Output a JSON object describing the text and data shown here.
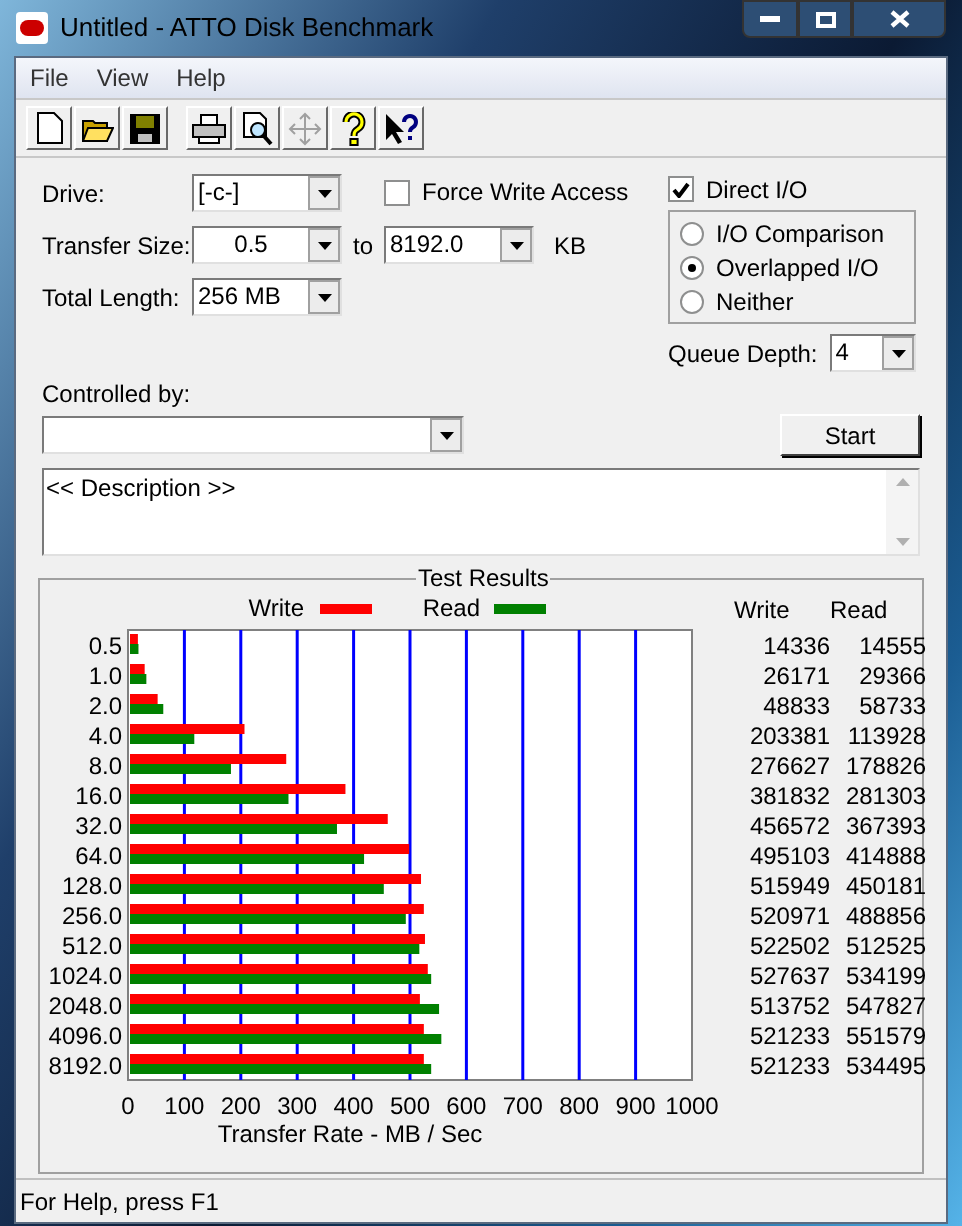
{
  "window": {
    "title": "Untitled - ATTO Disk Benchmark"
  },
  "menu": [
    "File",
    "View",
    "Help"
  ],
  "toolbar": [
    {
      "kind": "new",
      "disabled": false
    },
    {
      "kind": "open",
      "disabled": false
    },
    {
      "kind": "save",
      "disabled": false
    },
    {
      "kind": "print",
      "disabled": false
    },
    {
      "kind": "preview",
      "disabled": false
    },
    {
      "kind": "move",
      "disabled": true
    },
    {
      "kind": "help",
      "disabled": false
    },
    {
      "kind": "context-help",
      "disabled": false
    }
  ],
  "form": {
    "drive": {
      "label": "Drive:",
      "value": "[-c-]"
    },
    "force_write_access": {
      "label": "Force Write Access",
      "checked": false
    },
    "direct_io": {
      "label": "Direct I/O",
      "checked": true
    },
    "transfer_size": {
      "label": "Transfer Size:",
      "from": "0.5",
      "to_label": "to",
      "to": "8192.0",
      "unit": "KB"
    },
    "total_length": {
      "label": "Total Length:",
      "value": "256 MB"
    },
    "io_mode": [
      {
        "label": "I/O Comparison",
        "selected": false
      },
      {
        "label": "Overlapped I/O",
        "selected": true
      },
      {
        "label": "Neither",
        "selected": false
      }
    ],
    "queue_depth": {
      "label": "Queue Depth:",
      "value": "4"
    },
    "controlled_by": {
      "label": "Controlled by:"
    },
    "start_button": "Start",
    "description": "<< Description >>"
  },
  "test_results": {
    "title": "Test Results",
    "chart_data": {
      "type": "bar",
      "orientation": "horizontal",
      "grid": true,
      "legend": true,
      "xlabel": "Transfer Rate - MB / Sec",
      "xlim": [
        0,
        1000
      ],
      "xticks": [
        0,
        100,
        200,
        300,
        400,
        500,
        600,
        700,
        800,
        900,
        1000
      ],
      "categories": [
        "0.5",
        "1.0",
        "2.0",
        "4.0",
        "8.0",
        "16.0",
        "32.0",
        "64.0",
        "128.0",
        "256.0",
        "512.0",
        "1024.0",
        "2048.0",
        "4096.0",
        "8192.0"
      ],
      "series": [
        {
          "name": "Write",
          "color": "#ff0000",
          "values": [
            14,
            26,
            49,
            203,
            277,
            382,
            457,
            495,
            516,
            521,
            523,
            528,
            514,
            521,
            521
          ]
        },
        {
          "name": "Read",
          "color": "#008000",
          "values": [
            15,
            29,
            59,
            114,
            179,
            281,
            367,
            415,
            450,
            489,
            513,
            534,
            548,
            552,
            534
          ]
        }
      ]
    },
    "table": {
      "columns": [
        "Write",
        "Read"
      ],
      "rows": [
        [
          "14336",
          "14555"
        ],
        [
          "26171",
          "29366"
        ],
        [
          "48833",
          "58733"
        ],
        [
          "203381",
          "113928"
        ],
        [
          "276627",
          "178826"
        ],
        [
          "381832",
          "281303"
        ],
        [
          "456572",
          "367393"
        ],
        [
          "495103",
          "414888"
        ],
        [
          "515949",
          "450181"
        ],
        [
          "520971",
          "488856"
        ],
        [
          "522502",
          "512525"
        ],
        [
          "527637",
          "534199"
        ],
        [
          "513752",
          "547827"
        ],
        [
          "521233",
          "551579"
        ],
        [
          "521233",
          "534495"
        ]
      ]
    }
  },
  "status_bar": "For Help, press F1"
}
